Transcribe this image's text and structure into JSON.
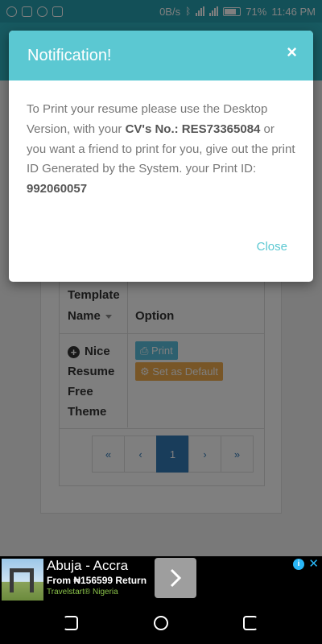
{
  "status_bar": {
    "network_speed": "0B/s",
    "battery": "71%",
    "time": "11:46 PM"
  },
  "table": {
    "header_name": "Template Name",
    "header_option": "Option",
    "row_name": "Nice Resume Free Theme",
    "print_label": "Print",
    "set_default_label": "Set as Default",
    "pagination": [
      "«",
      "‹",
      "1",
      "›",
      "»"
    ],
    "active_page": "1"
  },
  "modal": {
    "title": "Notification!",
    "close_symbol": "×",
    "body_intro": "To Print your resume please use the Desktop Version, with your ",
    "cv_label": "CV's No.: RES73365084",
    "body_mid": " or you want a friend to print for you, give out the print ID Generated by the System. your Print ID: ",
    "print_id": "992060057",
    "close_button": "Close"
  },
  "ad": {
    "title": "Abuja - Accra",
    "subtitle": "From ₦156599 Return",
    "brand": "Travelstart® Nigeria",
    "info_symbol": "i",
    "close_symbol": "✕"
  },
  "colors": {
    "header_teal": "#5bc8d2",
    "print_btn": "#5bc0de",
    "default_btn": "#f0ad4e",
    "pager_active": "#337ab7"
  }
}
